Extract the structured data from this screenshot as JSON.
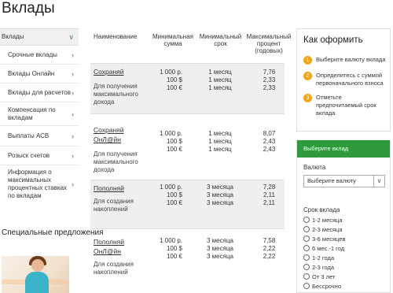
{
  "page": {
    "title": "Вклады"
  },
  "sidebar": {
    "items": [
      {
        "label": "Вклады"
      },
      {
        "label": "Срочные вклады"
      },
      {
        "label": "Вклады Онлайн"
      },
      {
        "label": "Вклады для расчетов"
      },
      {
        "label": "Компенсация по вкладам"
      },
      {
        "label": "Выплаты АСВ"
      },
      {
        "label": "Розыск счетов"
      },
      {
        "label": "Информация о максимальных процентных ставках по вкладам"
      }
    ],
    "special_title": "Специальные предложения"
  },
  "table": {
    "headers": {
      "name": "Наименование",
      "min_sum": "Минимальная сумма",
      "min_term": "Минимальный срок",
      "max_pct": "Максимальный процент (годовых)"
    },
    "rows": [
      {
        "name": "Сохраняй",
        "desc": "Для получения максимального дохода",
        "sums": [
          "1 000 р.",
          "100 $",
          "100 €"
        ],
        "terms": [
          "1 месяц",
          "1 месяц",
          "1 месяц"
        ],
        "pcts": [
          "7,76",
          "2,33",
          "2,33"
        ]
      },
      {
        "name": "Сохраняй ОнЛ@йн",
        "desc": "Для получения максимального дохода",
        "sums": [
          "1 000 р.",
          "100 $",
          "100 €"
        ],
        "terms": [
          "1 месяц",
          "1 месяц",
          "1 месяц"
        ],
        "pcts": [
          "8,07",
          "2,43",
          "2,43"
        ]
      },
      {
        "name": "Пополняй",
        "desc": "Для создания накоплений",
        "sums": [
          "1 000 р.",
          "100 $",
          "100 €"
        ],
        "terms": [
          "3 месяца",
          "3 месяца",
          "3 месяца"
        ],
        "pcts": [
          "7,28",
          "2,11",
          "2,11"
        ]
      },
      {
        "name": "Пополняй ОнЛ@йн",
        "desc": "Для создания накоплений",
        "sums": [
          "1 000 р.",
          "100 $",
          "100 €"
        ],
        "terms": [
          "3 месяца",
          "3 месяца",
          "3 месяца"
        ],
        "pcts": [
          "7,58",
          "2,22",
          "2,22"
        ]
      }
    ]
  },
  "how": {
    "title": "Как оформить",
    "steps": [
      {
        "num": "1",
        "text": "Выберите валюту вклада"
      },
      {
        "num": "2",
        "text": "Определитесь с суммой первоначального взноса"
      },
      {
        "num": "3",
        "text": "Отметьте предпочитаемый срок вклада"
      }
    ]
  },
  "choose": {
    "header": "Выберите вклад",
    "currency_label": "Валюта",
    "currency_value": "Выберите валюту",
    "term_label": "Срок вклада",
    "terms": [
      "1-2 месяца",
      "2-3 месяца",
      "3-6 месяцев",
      "6 мес.-1 год",
      "1-2 года",
      "2-3 года",
      "От 3 лет",
      "Бессрочно"
    ]
  },
  "colors": {
    "accent_green": "#2e9a3c",
    "step_orange": "#f2a516"
  }
}
